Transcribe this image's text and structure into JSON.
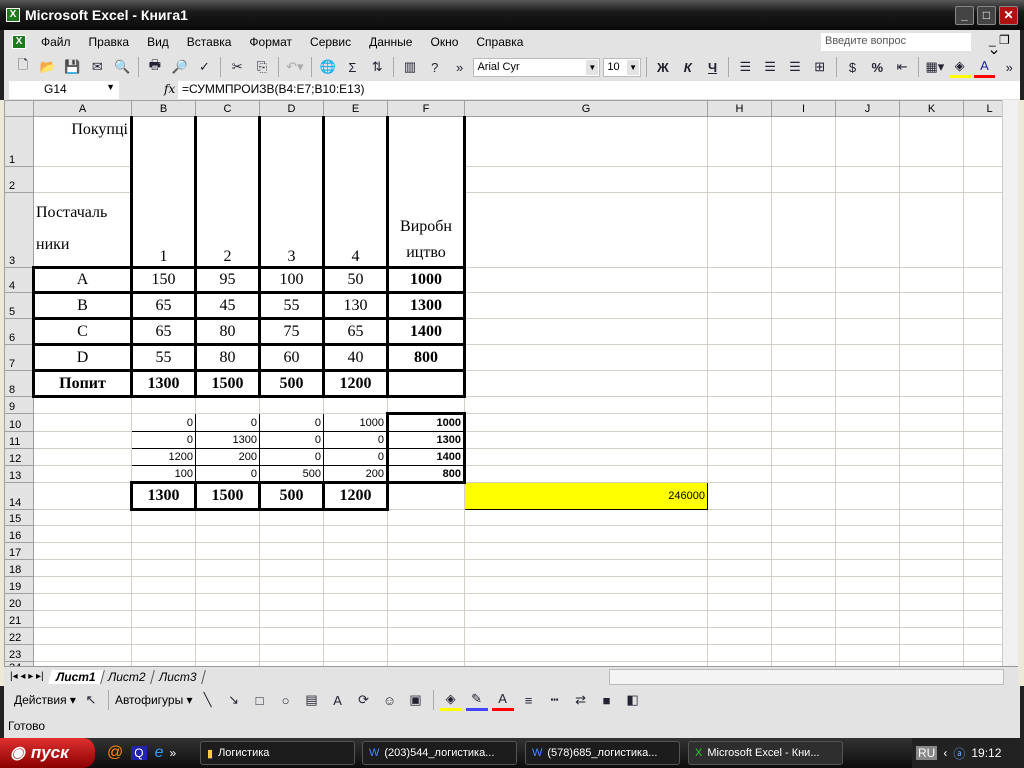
{
  "window": {
    "title": "Microsoft Excel - Книга1"
  },
  "menu": [
    "Файл",
    "Правка",
    "Вид",
    "Вставка",
    "Формат",
    "Сервис",
    "Данные",
    "Окно",
    "Справка"
  ],
  "help_placeholder": "Введите вопрос",
  "toolbar": {
    "font": "Arial Cyr",
    "size": "10",
    "bold": "Ж",
    "italic": "К",
    "underline": "Ч",
    "percent": "%",
    "sum": "Σ"
  },
  "formula_bar": {
    "cell": "G14",
    "fx": "fx",
    "formula": "=СУММПРОИЗВ(B4:E7;B10:E13)"
  },
  "columns": [
    "A",
    "B",
    "C",
    "D",
    "E",
    "F",
    "G",
    "H",
    "I",
    "J",
    "K",
    "L"
  ],
  "cells": {
    "A1": "Покупці",
    "A3a": "Постачаль",
    "A3b": "ники",
    "B3": "1",
    "C3": "2",
    "D3": "3",
    "E3": "4",
    "F3a": "Виробн",
    "F3b": "ицтво",
    "rows4_8": [
      [
        "A",
        "150",
        "95",
        "100",
        "50",
        "1000"
      ],
      [
        "B",
        "65",
        "45",
        "55",
        "130",
        "1300"
      ],
      [
        "C",
        "65",
        "80",
        "75",
        "65",
        "1400"
      ],
      [
        "D",
        "55",
        "80",
        "60",
        "40",
        "800"
      ],
      [
        "Попит",
        "1300",
        "1500",
        "500",
        "1200",
        ""
      ]
    ],
    "rows10_13": [
      [
        "0",
        "0",
        "0",
        "1000",
        "1000"
      ],
      [
        "0",
        "1300",
        "0",
        "0",
        "1300"
      ],
      [
        "1200",
        "200",
        "0",
        "0",
        "1400"
      ],
      [
        "100",
        "0",
        "500",
        "200",
        "800"
      ]
    ],
    "row14": [
      "1300",
      "1500",
      "500",
      "1200"
    ],
    "G14": "246000"
  },
  "highlight_color": "#ffff00",
  "sheets": [
    "Лист1",
    "Лист2",
    "Лист3"
  ],
  "drawing": {
    "actions": "Действия ▾",
    "autoshapes": "Автофигуры ▾"
  },
  "status": "Готово",
  "taskbar": {
    "start": "пуск",
    "items": [
      "Логистика",
      "(203)544_логистика...",
      "(578)685_логистика...",
      "Microsoft Excel - Кни..."
    ],
    "lang": "RU",
    "time": "19:12"
  }
}
